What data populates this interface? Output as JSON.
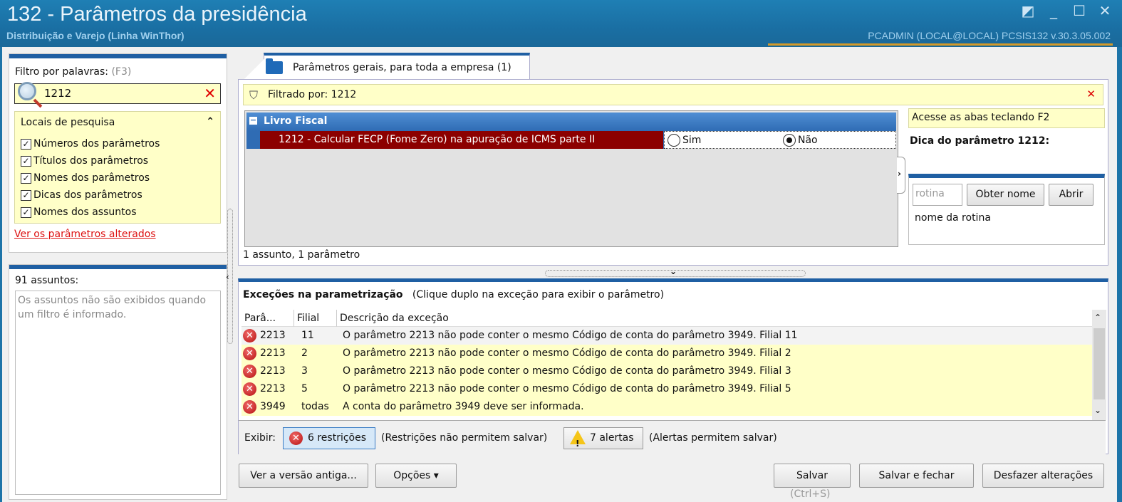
{
  "window": {
    "title": "132 - Parâmetros da presidência",
    "subtitle": "Distribuição e Varejo (Linha WinThor)",
    "user_info": "PCADMIN (LOCAL@LOCAL)   PCSIS132  v.30.3.05.002",
    "controls": [
      "restore-icon",
      "minimize-icon",
      "maximize-icon",
      "close-icon"
    ]
  },
  "filter": {
    "label": "Filtro por palavras:",
    "hint": "(F3)",
    "value": "1212",
    "clear_glyph": "✕"
  },
  "locais": {
    "title": "Locais de pesquisa",
    "collapse_glyph": "⌃",
    "options": [
      {
        "label": "Números dos parâmetros",
        "checked": true
      },
      {
        "label": "Títulos dos parâmetros",
        "checked": true
      },
      {
        "label": "Nomes dos parâmetros",
        "checked": true
      },
      {
        "label": "Dicas dos parâmetros",
        "checked": true
      },
      {
        "label": "Nomes dos assuntos",
        "checked": true
      }
    ],
    "link_alterados": "Ver os parâmetros alterados"
  },
  "assuntos": {
    "count_label": "91 assuntos:",
    "message": "Os assuntos não são exibidos quando um filtro é informado."
  },
  "tab": {
    "label": "Parâmetros gerais, para toda a empresa  (1)"
  },
  "filtered_by": {
    "label": "Filtrado por: 1212",
    "close_glyph": "✕"
  },
  "grid": {
    "group": "Livro Fiscal",
    "row": {
      "label": "1212 - Calcular FECP (Fome Zero) na apuração de ICMS parte II",
      "option_yes": "Sim",
      "option_no": "Não",
      "selected": "Não"
    },
    "summary": "1 assunto, 1 parâmetro"
  },
  "tip": {
    "access_hint": "Acesse as abas teclando F2",
    "title": "Dica do parâmetro 1212:",
    "rotina_placeholder": "rotina",
    "btn_obter": "Obter nome",
    "btn_abrir": "Abrir",
    "nome_rotina": "nome da rotina"
  },
  "exceptions": {
    "title": "Exceções na parametrização",
    "hint": "(Clique duplo na exceção para exibir o parâmetro)",
    "columns": [
      "Parâ...",
      "Filial",
      "Descrição da exceção"
    ],
    "rows": [
      {
        "param": "2213",
        "filial": "11",
        "desc": "O parâmetro 2213 não pode conter o mesmo Código de conta do parâmetro 3949. Filial 11"
      },
      {
        "param": "2213",
        "filial": "2",
        "desc": "O parâmetro 2213 não pode conter o mesmo Código de conta do parâmetro 3949. Filial 2"
      },
      {
        "param": "2213",
        "filial": "3",
        "desc": "O parâmetro 2213 não pode conter o mesmo Código de conta do parâmetro 3949. Filial 3"
      },
      {
        "param": "2213",
        "filial": "5",
        "desc": "O parâmetro 2213 não pode conter o mesmo Código de conta do parâmetro 3949. Filial 5"
      },
      {
        "param": "3949",
        "filial": "todas",
        "desc": "A conta do parâmetro 3949 deve ser informada."
      }
    ],
    "exibir_label": "Exibir:",
    "restricoes_btn": "6 restrições",
    "restricoes_txt": "(Restrições não permitem salvar)",
    "alertas_btn": "7 alertas",
    "alertas_txt": "(Alertas permitem salvar)"
  },
  "footer": {
    "versao_antiga": "Ver a versão antiga...",
    "opcoes": "Opções ▾",
    "salvar": "Salvar",
    "salvar_fechar": "Salvar e fechar",
    "desfazer": "Desfazer alterações",
    "shortcut": "(Ctrl+S)"
  },
  "colors": {
    "title_bg": "#1a6fa3",
    "accent": "#1f5fa3",
    "highlight_row": "#8c0000",
    "yellow_bg": "#ffffc8",
    "link_red": "#dd1111"
  }
}
